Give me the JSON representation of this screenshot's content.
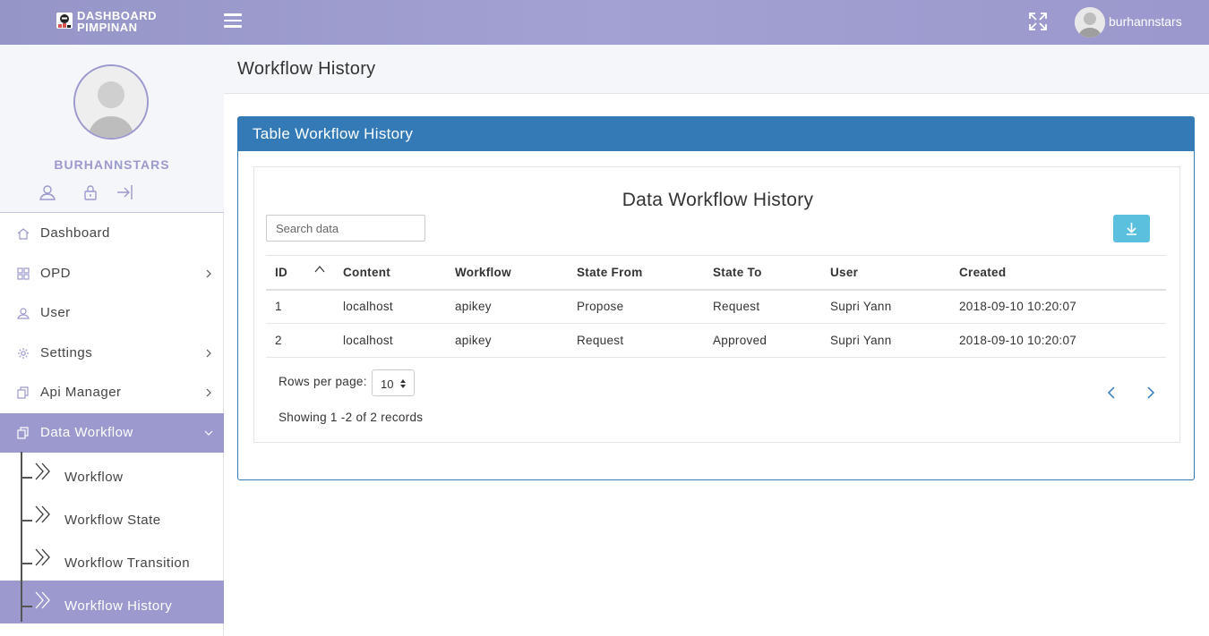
{
  "brand": {
    "line1": "DASHBOARD",
    "line2": "PIMPINAN"
  },
  "topbar": {
    "username": "burhannstars"
  },
  "profile": {
    "name": "BURHANNSTARS"
  },
  "menu": [
    {
      "label": "Dashboard",
      "icon": "home-icon"
    },
    {
      "label": "OPD",
      "icon": "grid-icon"
    },
    {
      "label": "User",
      "icon": "user-icon"
    },
    {
      "label": "Settings",
      "icon": "gear-icon"
    },
    {
      "label": "Api Manager",
      "icon": "copy-icon"
    },
    {
      "label": "Data Workflow",
      "icon": "copy-icon"
    }
  ],
  "submenu": [
    {
      "label": "Workflow"
    },
    {
      "label": "Workflow State"
    },
    {
      "label": "Workflow Transition"
    },
    {
      "label": "Workflow History"
    }
  ],
  "page": {
    "title": "Workflow History"
  },
  "card": {
    "title": "Table Workflow History"
  },
  "table": {
    "title": "Data Workflow History",
    "search_placeholder": "Search data",
    "columns": [
      "ID",
      "Content",
      "Workflow",
      "State From",
      "State To",
      "User",
      "Created"
    ],
    "rows": [
      [
        "1",
        "localhost",
        "apikey",
        "Propose",
        "Request",
        "Supri Yann",
        "2018-09-10 10:20:07"
      ],
      [
        "2",
        "localhost",
        "apikey",
        "Request",
        "Approved",
        "Supri Yann",
        "2018-09-10 10:20:07"
      ]
    ],
    "rows_per_page_label": "Rows per page:",
    "rows_per_page": "10",
    "showing": "Showing 1 -2 of 2 records"
  },
  "colors": {
    "accent": "#9b99cd",
    "primary": "#337ab7",
    "info": "#5bc0de"
  }
}
